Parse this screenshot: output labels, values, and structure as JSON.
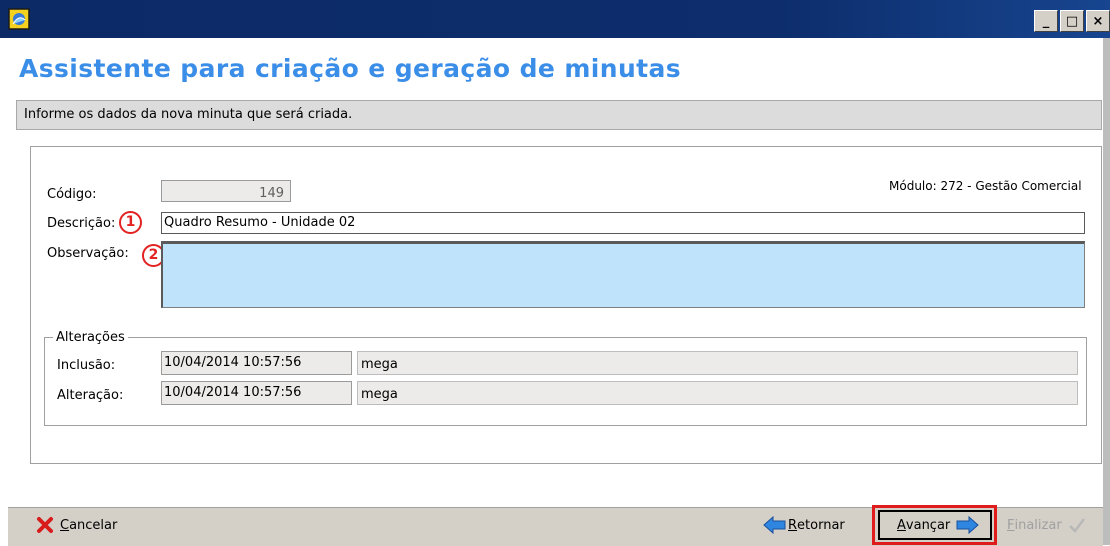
{
  "window": {
    "minimize_glyph": "_",
    "maximize_glyph": "□",
    "close_glyph": "×"
  },
  "heading": "Assistente para criação e geração de minutas",
  "info_text": "Informe os dados da nova minuta que será criada.",
  "form": {
    "codigo_label": "Código:",
    "codigo_value": "149",
    "modulo_text": "Módulo: 272 - Gestão Comercial",
    "descricao_label": "Descrição:",
    "descricao_value": "Quadro Resumo - Unidade 02",
    "observacao_label": "Observação:",
    "observacao_value": "",
    "badge_1": "1",
    "badge_2": "2"
  },
  "alteracoes": {
    "legend": "Alterações",
    "rows": [
      {
        "label": "Inclusão:",
        "datetime": "10/04/2014 10:57:56",
        "user": "mega"
      },
      {
        "label": "Alteração:",
        "datetime": "10/04/2014 10:57:56",
        "user": "mega"
      }
    ]
  },
  "buttons": {
    "cancelar_first": "C",
    "cancelar_rest": "ancelar",
    "retornar_first": "R",
    "retornar_rest": "etornar",
    "avancar_first": "A",
    "avancar_rest": "vançar",
    "finalizar_first": "F",
    "finalizar_rest": "inalizar"
  },
  "colors": {
    "heading": "#3b8ee8",
    "observacao_bg": "#bfe3fb",
    "highlight_red": "#e32222"
  }
}
